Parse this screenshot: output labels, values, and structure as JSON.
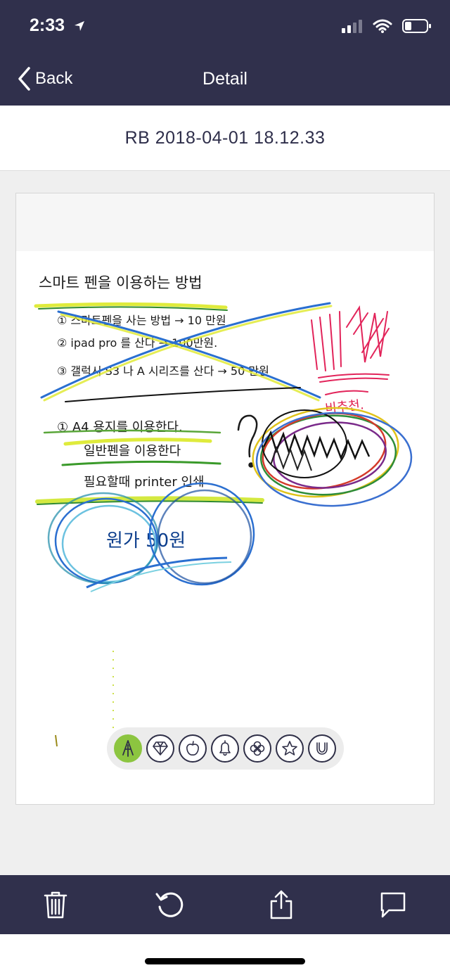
{
  "status": {
    "time": "2:33"
  },
  "nav": {
    "back_label": "Back",
    "title": "Detail"
  },
  "document": {
    "title": "RB 2018-04-01 18.12.33",
    "note_lines": [
      "스마트 펜을 이용하는 방법",
      "① 스마트펜을 사는 방법 → 10 만원",
      "② ipad pro 를 산다 → 100만원.",
      "③ 갤럭시 S3 나 A 시리즈를 산다 → 50 만원",
      "① A4 용지를 이용한다.",
      "일반펜을 이용한다",
      "필요할때 printer 인쇄",
      "원가 50원",
      "비추천."
    ]
  },
  "stamps": [
    {
      "icon": "pen-nib-icon",
      "active": true
    },
    {
      "icon": "diamond-icon",
      "active": false
    },
    {
      "icon": "apple-icon",
      "active": false
    },
    {
      "icon": "bell-icon",
      "active": false
    },
    {
      "icon": "clover-icon",
      "active": false
    },
    {
      "icon": "star-icon",
      "active": false
    },
    {
      "icon": "horseshoe-icon",
      "active": false
    }
  ],
  "toolbar": {
    "icons": [
      "trash-icon",
      "rotate-icon",
      "share-icon",
      "comment-icon"
    ]
  },
  "colors": {
    "nav_bg": "#30304c",
    "accent_green": "#8cc540"
  }
}
